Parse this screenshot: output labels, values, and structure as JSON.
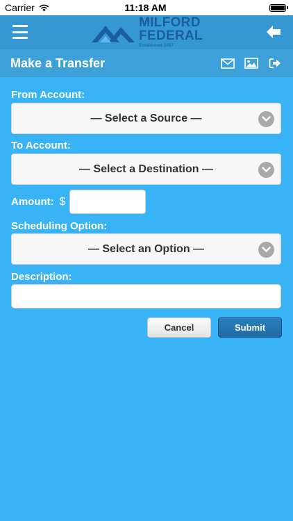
{
  "status_bar": {
    "carrier": "Carrier",
    "time": "11:18 AM",
    "icons": [
      "wifi-icon",
      "battery-icon"
    ]
  },
  "header": {
    "logo_line1": "MILFORD",
    "logo_line2": "FEDERAL",
    "logo_tagline": "Established 1887",
    "menu_icon": "hamburger-menu-icon",
    "back_icon": "back-arrow-icon"
  },
  "title_bar": {
    "title": "Make a Transfer",
    "icons": [
      "envelope-icon",
      "image-icon",
      "logout-icon"
    ]
  },
  "form": {
    "from_label": "From Account:",
    "from_selected": "— Select a Source —",
    "to_label": "To Account:",
    "to_selected": "— Select a Destination —",
    "amount_label": "Amount:",
    "currency_symbol": "$",
    "amount_value": "",
    "scheduling_label": "Scheduling Option:",
    "scheduling_selected": "— Select an Option —",
    "description_label": "Description:",
    "description_value": "",
    "cancel_label": "Cancel",
    "submit_label": "Submit"
  },
  "colors": {
    "background": "#38b3f6",
    "header": "#3598d3",
    "title_bar": "#3ea0d8",
    "logo": "#1a5ea0",
    "submit": "#1f6aa5"
  }
}
